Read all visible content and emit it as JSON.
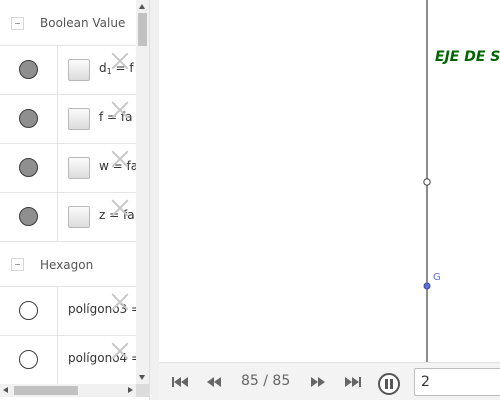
{
  "algebra": {
    "groups": [
      {
        "label": "Boolean Value",
        "rows": [
          {
            "name": "d",
            "sub": "1",
            "text": " = f",
            "marble": "on",
            "checkbox": true
          },
          {
            "name": "f",
            "sub": "",
            "text": " = fa",
            "marble": "on",
            "checkbox": true
          },
          {
            "name": "w",
            "sub": "",
            "text": " = fa",
            "marble": "on",
            "checkbox": true
          },
          {
            "name": "z",
            "sub": "",
            "text": " = fa",
            "marble": "on",
            "checkbox": true
          }
        ]
      },
      {
        "label": "Hexagon",
        "rows": [
          {
            "name": "polígono3",
            "sub": "",
            "text": " =",
            "marble": "off",
            "checkbox": false
          },
          {
            "name": "polígono4",
            "sub": "",
            "text": " =",
            "marble": "off",
            "checkbox": false
          }
        ]
      }
    ]
  },
  "graphics": {
    "axis_title": "EJE DE S",
    "point_label": "G",
    "colors": {
      "axis_title": "#006600",
      "point": "#5d6fd6",
      "line": "#1a1a1a"
    }
  },
  "navigation": {
    "step_text": "85 / 85",
    "speed_value": "2",
    "icons": [
      "skip-first-icon",
      "step-back-icon",
      "step-forward-icon",
      "skip-last-icon",
      "pause-icon"
    ]
  }
}
